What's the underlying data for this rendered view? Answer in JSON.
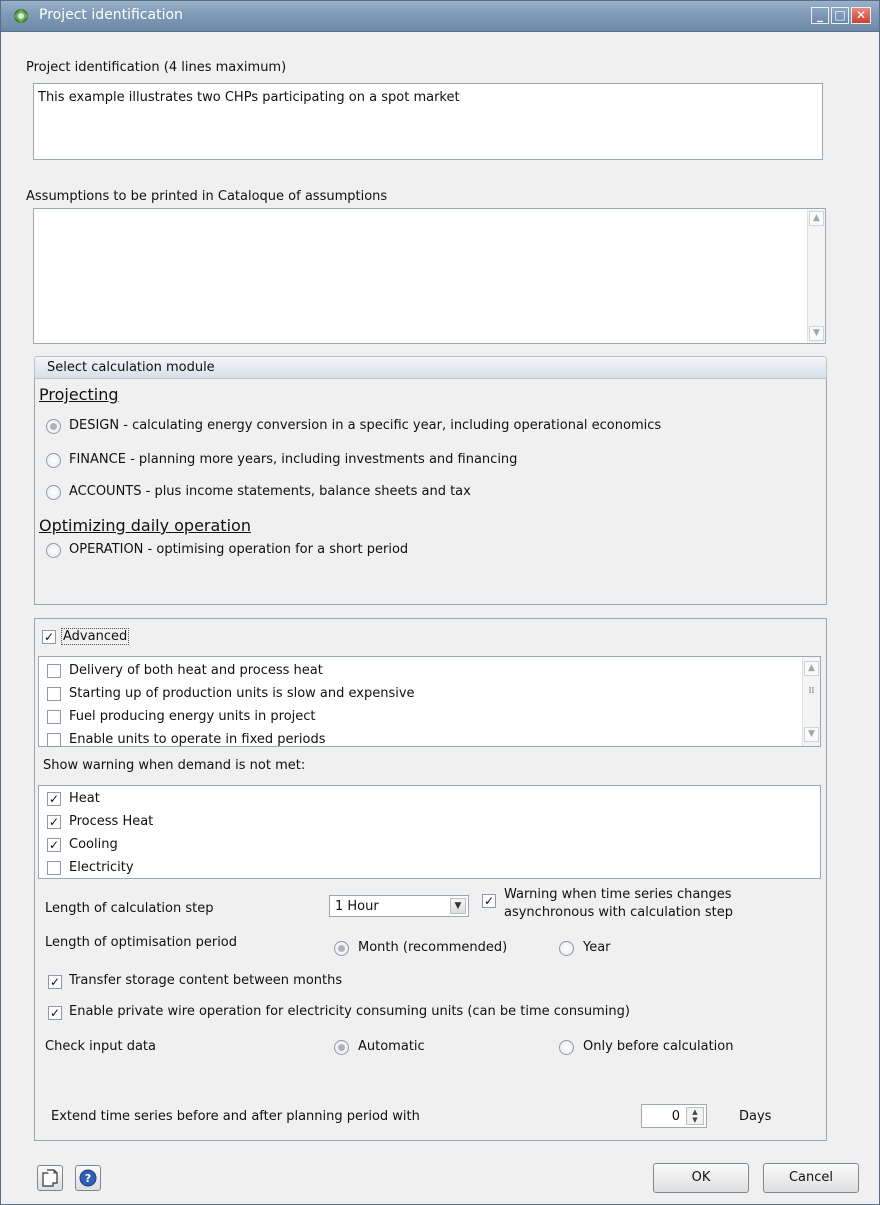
{
  "window": {
    "title": "Project identification"
  },
  "project": {
    "label": "Project identification  (4 lines maximum)",
    "value": "This example illustrates two CHPs participating on a spot market"
  },
  "assumptions": {
    "label": "Assumptions to be printed in Cataloque of assumptions",
    "value": ""
  },
  "module": {
    "header": "Select calculation module",
    "projecting_title": "Projecting",
    "options": [
      {
        "label": "DESIGN - calculating energy conversion in a specific year, including operational economics",
        "selected": true
      },
      {
        "label": "FINANCE - planning more years, including investments and financing",
        "selected": false
      },
      {
        "label": "ACCOUNTS - plus income statements, balance sheets and tax",
        "selected": false
      }
    ],
    "optimizing_title": "Optimizing daily operation",
    "operation_option": {
      "label": "OPERATION - optimising operation  for a short period",
      "selected": false
    }
  },
  "advanced": {
    "label": "Advanced",
    "checked": true,
    "options": [
      {
        "label": "Delivery of both heat and process heat",
        "checked": false
      },
      {
        "label": "Starting up of production units is slow and expensive",
        "checked": false
      },
      {
        "label": "Fuel producing energy units in project",
        "checked": false
      },
      {
        "label": "Enable units to operate in fixed periods",
        "checked": false
      }
    ],
    "warning_label": "Show warning when demand is not met:",
    "warnings": [
      {
        "label": "Heat",
        "checked": true
      },
      {
        "label": "Process Heat",
        "checked": true
      },
      {
        "label": "Cooling",
        "checked": true
      },
      {
        "label": "Electricity",
        "checked": false
      }
    ],
    "step_label": "Length of calculation step",
    "step_value": "1 Hour",
    "async_warning_line1": "Warning when time series changes",
    "async_warning_line2": "asynchronous with calculation step",
    "async_checked": true,
    "opt_period_label": "Length of optimisation period",
    "opt_month": "Month (recommended)",
    "opt_year": "Year",
    "transfer_label": "Transfer storage content between months",
    "private_wire_label": "Enable private wire operation for electricity consuming units (can be time consuming)",
    "check_input_label": "Check input data",
    "check_auto": "Automatic",
    "check_before": "Only before calculation",
    "extend_label": "Extend time series before and after planning period with",
    "extend_value": "0",
    "extend_unit": "Days"
  },
  "buttons": {
    "ok": "OK",
    "cancel": "Cancel"
  },
  "icons": {
    "copy": "copy-icon",
    "help": "help-icon"
  }
}
